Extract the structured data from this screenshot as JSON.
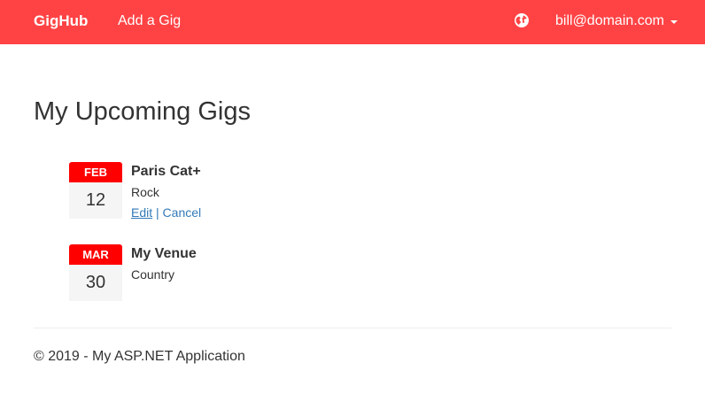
{
  "navbar": {
    "brand": "GigHub",
    "add_gig_label": "Add a Gig",
    "globe_icon": "globe-icon",
    "user_email": "bill@domain.com",
    "caret_icon": "caret-down-icon",
    "bg_color": "#ff4345"
  },
  "main": {
    "title": "My Upcoming Gigs",
    "gigs": [
      {
        "month": "FEB",
        "day": "12",
        "venue": "Paris Cat+",
        "genre": "Rock",
        "edit_label": "Edit",
        "separator": "|",
        "cancel_label": "Cancel"
      },
      {
        "month": "MAR",
        "day": "30",
        "venue": "My Venue",
        "genre": "Country"
      }
    ]
  },
  "footer": {
    "text": "© 2019 - My ASP.NET Application"
  }
}
